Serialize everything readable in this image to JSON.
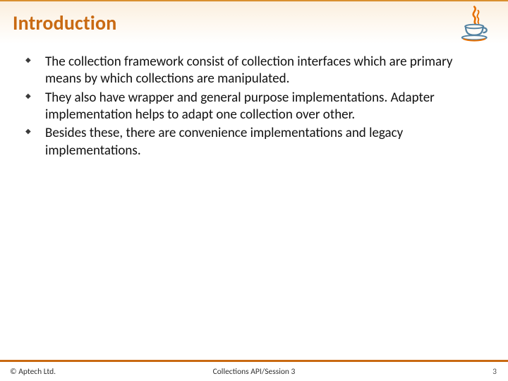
{
  "header": {
    "title": "Introduction",
    "logo_name": "java-logo"
  },
  "content": {
    "bullets": [
      "The collection framework consist of collection interfaces which are primary means by which collections are manipulated.",
      "They also have wrapper and general purpose implementations. Adapter implementation helps to adapt one collection over other.",
      "Besides these, there are convenience implementations and legacy implementations."
    ]
  },
  "footer": {
    "copyright": "© Aptech Ltd.",
    "session": "Collections API/Session 3",
    "page": "3"
  }
}
